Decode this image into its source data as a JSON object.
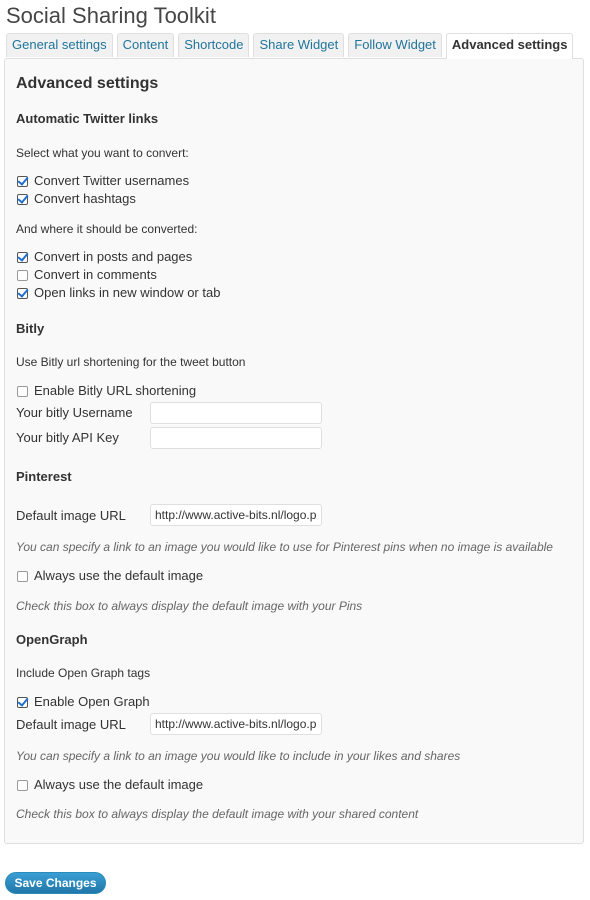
{
  "page_title": "Social Sharing Toolkit",
  "tabs": [
    {
      "label": "General settings"
    },
    {
      "label": "Content"
    },
    {
      "label": "Shortcode"
    },
    {
      "label": "Share Widget"
    },
    {
      "label": "Follow Widget"
    },
    {
      "label": "Advanced settings",
      "active": true
    }
  ],
  "panel": {
    "heading": "Advanced settings",
    "twitter": {
      "heading": "Automatic Twitter links",
      "select_text": "Select what you want to convert:",
      "convert_usernames": {
        "label": "Convert Twitter usernames",
        "checked": true
      },
      "convert_hashtags": {
        "label": "Convert hashtags",
        "checked": true
      },
      "where_text": "And where it should be converted:",
      "in_posts": {
        "label": "Convert in posts and pages",
        "checked": true
      },
      "in_comments": {
        "label": "Convert in comments",
        "checked": false
      },
      "new_window": {
        "label": "Open links in new window or tab",
        "checked": true
      }
    },
    "bitly": {
      "heading": "Bitly",
      "desc_text": "Use Bitly url shortening for the tweet button",
      "enable": {
        "label": "Enable Bitly URL shortening",
        "checked": false
      },
      "username_label": "Your bitly Username",
      "username_value": "",
      "apikey_label": "Your bitly API Key",
      "apikey_value": ""
    },
    "pinterest": {
      "heading": "Pinterest",
      "image_label": "Default image URL",
      "image_value": "http://www.active-bits.nl/logo.p",
      "image_help": "You can specify a link to an image you would like to use for Pinterest pins when no image is available",
      "always": {
        "label": "Always use the default image",
        "checked": false
      },
      "always_help": "Check this box to always display the default image with your Pins"
    },
    "opengraph": {
      "heading": "OpenGraph",
      "include_text": "Include Open Graph tags",
      "enable": {
        "label": "Enable Open Graph",
        "checked": true
      },
      "image_label": "Default image URL",
      "image_value": "http://www.active-bits.nl/logo.p",
      "image_help": "You can specify a link to an image you would like to include in your likes and shares",
      "always": {
        "label": "Always use the default image",
        "checked": false
      },
      "always_help": "Check this box to always display the default image with your shared content"
    }
  },
  "save_label": "Save Changes"
}
